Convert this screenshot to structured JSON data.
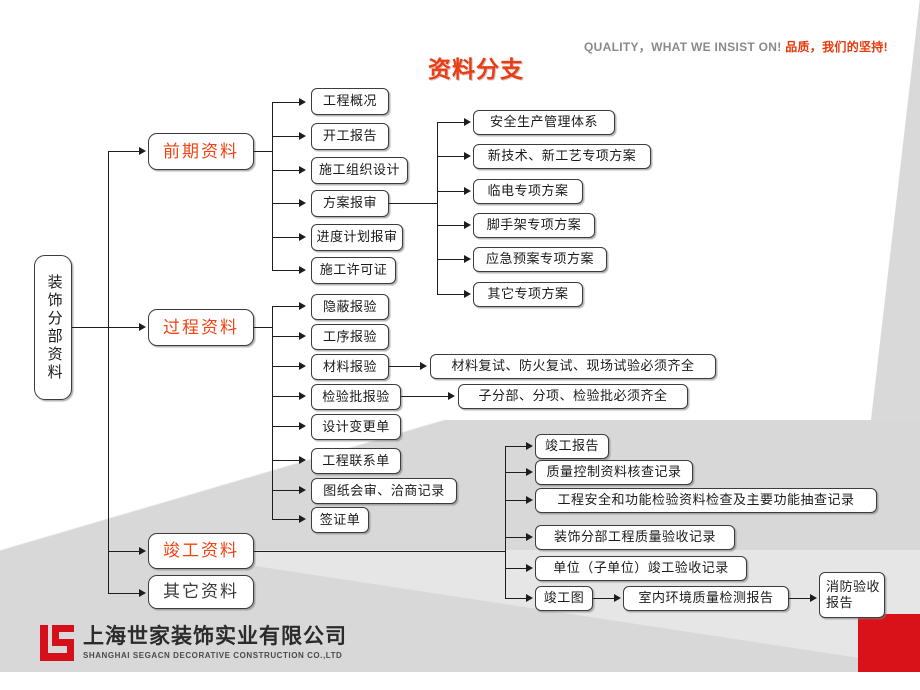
{
  "slide": {
    "title": "资料分支",
    "slogan_en": "QUALITY，WHAT WE INSIST ON!",
    "slogan_cn": "品质，我们的坚持!",
    "accent_color": "#f04414",
    "title_color": "#ef3b12",
    "logo_cn": "上海世家装饰实业有限公司",
    "logo_en": "SHANGHAI SEGACN DECORATIVE CONSTRUCTION CO.,LTD"
  },
  "diagram": {
    "type": "tree",
    "root": {
      "label": "装饰分部资料"
    },
    "branches": [
      {
        "label": "前期资料",
        "accent": true,
        "children": [
          {
            "label": "工程概况"
          },
          {
            "label": "开工报告"
          },
          {
            "label": "施工组织设计"
          },
          {
            "label": "方案报审",
            "children": [
              {
                "label": "安全生产管理体系"
              },
              {
                "label": "新技术、新工艺专项方案"
              },
              {
                "label": "临电专项方案"
              },
              {
                "label": "脚手架专项方案"
              },
              {
                "label": "应急预案专项方案"
              },
              {
                "label": "其它专项方案"
              }
            ]
          },
          {
            "label": "进度计划报审"
          },
          {
            "label": "施工许可证"
          }
        ]
      },
      {
        "label": "过程资料",
        "accent": true,
        "children": [
          {
            "label": "隐蔽报验"
          },
          {
            "label": "工序报验"
          },
          {
            "label": "材料报验",
            "children": [
              {
                "label": "材料复试、防火复试、现场试验必须齐全"
              }
            ]
          },
          {
            "label": "检验批报验",
            "children": [
              {
                "label": "子分部、分项、检验批必须齐全"
              }
            ]
          },
          {
            "label": "设计变更单"
          },
          {
            "label": "工程联系单"
          },
          {
            "label": "图纸会审、洽商记录"
          },
          {
            "label": "签证单"
          }
        ]
      },
      {
        "label": "竣工资料",
        "accent": true,
        "children": [
          {
            "label": "竣工报告"
          },
          {
            "label": "质量控制资料核查记录"
          },
          {
            "label": "工程安全和功能检验资料检查及主要功能抽查记录"
          },
          {
            "label": "装饰分部工程质量验收记录"
          },
          {
            "label": "单位（子单位）竣工验收记录"
          },
          {
            "label": "竣工图",
            "children": [
              {
                "label": "室内环境质量检测报告",
                "children": [
                  {
                    "label": "消防验收报告"
                  }
                ]
              }
            ]
          }
        ]
      },
      {
        "label": "其它资料",
        "accent": false,
        "children": []
      }
    ]
  }
}
